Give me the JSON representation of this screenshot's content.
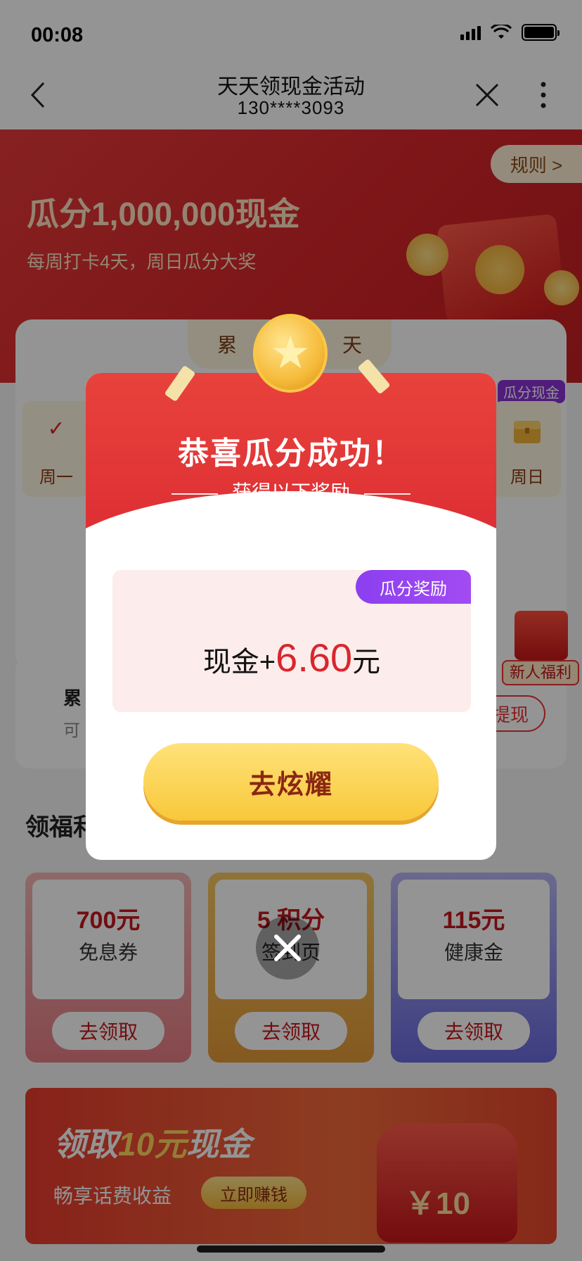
{
  "status_bar": {
    "time": "00:08"
  },
  "nav": {
    "title": "天天领现金活动",
    "subtitle": "130****3093"
  },
  "hero": {
    "title": "瓜分1,000,000现金",
    "subtitle": "每周打卡4天，周日瓜分大奖",
    "rules_label": "规则 >"
  },
  "checkin": {
    "tab_label_left": "累",
    "tab_label_right": "天",
    "days": [
      {
        "label": "周一",
        "mark": "✓"
      },
      {
        "label": "周日",
        "mark": ""
      }
    ],
    "sunday_badge": "瓜分现金"
  },
  "side_gift": {
    "label": "新人福利"
  },
  "wallet": {
    "title": "累",
    "subtitle": "可",
    "withdraw_label": "提现"
  },
  "section": {
    "title": "领福利"
  },
  "benefits": [
    {
      "amount": "700元",
      "name": "免息券",
      "button": "去领取"
    },
    {
      "amount": "5 积分",
      "name": "签到页",
      "button": "去领取"
    },
    {
      "amount": "115元",
      "name": "健康金",
      "button": "去领取"
    }
  ],
  "banner": {
    "title_prefix": "领取",
    "title_highlight": "10元",
    "title_suffix": "现金",
    "subtitle": "畅享话费收益",
    "button": "立即赚钱",
    "amount": "￥10"
  },
  "modal": {
    "title": "恭喜瓜分成功！",
    "subtitle": "获得以下奖励",
    "reward_tag": "瓜分奖励",
    "reward_label": "现金+",
    "reward_amount": "6.60",
    "reward_unit": "元",
    "action_button": "去炫耀"
  },
  "colors": {
    "primary_red": "#d9262c",
    "gold": "#f8c83a",
    "purple_tag": "#8b3ff0"
  }
}
